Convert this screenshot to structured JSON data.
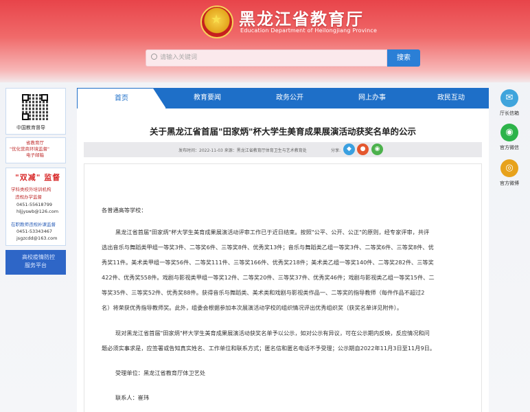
{
  "header": {
    "title": "黑龙江省教育厅",
    "subtitle": "Education Department of Heilongjiang Province"
  },
  "search": {
    "placeholder": "请输入关键词",
    "button": "搜索"
  },
  "left_sidebar": {
    "qr_label": "中国教育督导",
    "card2_line1": "省教育厅",
    "card2_line2": "\"优化营商环境监督\"",
    "card2_line3": "电子邮箱",
    "shuangjian_title": "\"双减\" 监督",
    "shuangjian_line1": "学科类校外培训机构",
    "shuangjian_line2": "违规办学监督",
    "shuangjian_phone1": "0451-55618799",
    "shuangjian_email1": "hljjyswb@126.com",
    "fee_line": "在职教师违规补课监督",
    "fee_phone": "0451-53343467",
    "fee_email": "jsgzcdd@163.com",
    "campus_line1": "高校疫情防控",
    "campus_line2": "服务平台"
  },
  "nav": {
    "items": [
      "首页",
      "教育要闻",
      "政务公开",
      "网上办事",
      "政民互动"
    ],
    "active": "首页"
  },
  "article": {
    "title": "关于黑龙江省首届\"田家炳\"杯大学生美育成果展演活动获奖名单的公示",
    "meta": "发布时间：2022-11-03 来源：黑龙江省教育厅体育卫生与艺术教育处",
    "share_label": "分享:",
    "greeting": "各普通高等学校：",
    "p1_l1": "黑龙江省首届\"田家炳\"杯大学生美育成果展演活动评审工作已于近日结束。按照\"公平、公开、公正\"的原则，经专家评审，共评",
    "p1_l2": "选出音乐与舞蹈类甲组一等奖3件、二等奖6件、三等奖8件、优秀奖13件；音乐与舞蹈类乙组一等奖3件、二等奖6件、三等奖8件、优",
    "p1_l3": "秀奖11件。美术类甲组一等奖56件、二等奖111件、三等奖166件、优秀奖218件；美术类乙组一等奖140件、二等奖282件、三等奖",
    "p1_l4": "422件、优秀奖558件。戏剧与影视类甲组一等奖12件、二等奖20件、三等奖37件、优秀奖46件；戏剧与影视类乙组一等奖15件、二",
    "p1_l5": "等奖35件、三等奖52件、优秀奖88件。获得音乐与舞蹈类、美术类和戏剧与影视类作品一、二等奖的指导教师（每件作品不超过2",
    "p1_l6": "名）将荣获优秀指导教师奖。此外，组委会根据参加本次展演活动学校的组织情况评出优秀组织奖（获奖名单详见附件）。",
    "p2_l1": "现对黑龙江省首届\"田家炳\"杯大学生美育成果展演活动获奖名单予以公示，如对公示有异议，可在公示期内反映，反应情况和问",
    "p2_l2": "题必须实事求是，应签署或告知真实姓名、工作单位和联系方式；匿名信和匿名电话不予受理；公示期自2022年11月3日至11月9日。",
    "accept_unit": "受理单位：黑龙江省教育厅体卫艺处",
    "contact": "联系人：崔玮"
  },
  "right_sidebar": {
    "items": [
      "厅长信箱",
      "官方微信",
      "官方微博"
    ]
  },
  "colors": {
    "banner_red": "#e8444a",
    "nav_blue": "#1e6fc8",
    "accent_red": "#d82828"
  }
}
